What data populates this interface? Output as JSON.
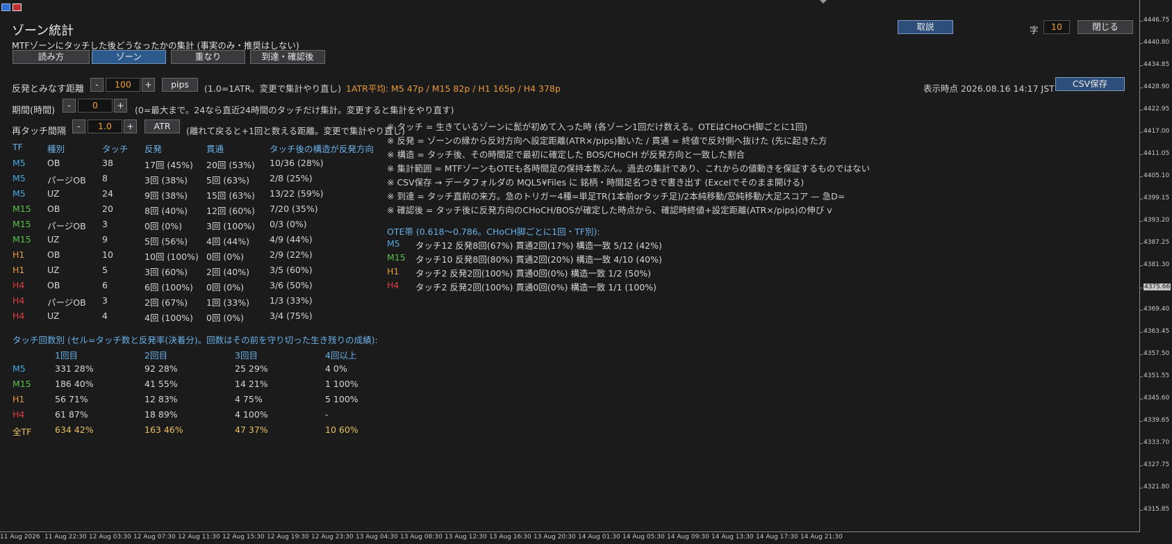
{
  "title": "ゾーン統計",
  "subtitle": "MTFゾーンにタッチした後どうなったかの集計 (事実のみ・推奨はしない)",
  "tabs": [
    "読み方",
    "ゾーン",
    "重なり",
    "到達・確認後"
  ],
  "active_tab": "ゾーン",
  "top_controls": {
    "explain_button": "取説",
    "font_label": "字",
    "font_size": "10",
    "close_button": "閉じる"
  },
  "reaction": {
    "label": "反発とみなす距離",
    "minus": "-",
    "value": "100",
    "plus": "+",
    "unit_button": "pips",
    "hint": "(1.0=1ATR。変更で集計やり直し)",
    "atr_avg": "1ATR平均: M5 47p / M15 82p / H1 165p / H4 378p",
    "timestamp": "表示時点 2026.08.16 14:17 JST",
    "csv_button": "CSV保存"
  },
  "period": {
    "label": "期間(時間)",
    "minus": "-",
    "value": "0",
    "plus": "+",
    "hint": "(0=最大まで。24なら直近24時間のタッチだけ集計。変更すると集計をやり直す)"
  },
  "retouch": {
    "label": "再タッチ間隔",
    "minus": "-",
    "value": "1.0",
    "plus": "+",
    "unit_button": "ATR",
    "hint": "(離れて戻ると+1回と数える距離。変更で集計やり直し)"
  },
  "table": {
    "headers": [
      "TF",
      "種別",
      "タッチ",
      "反発",
      "貫通",
      "タッチ後の構造が反発方向"
    ],
    "rows": [
      {
        "tf": "M5",
        "kind": "OB",
        "touch": "38",
        "bounce": "17回 (45%)",
        "pierce": "20回 (53%)",
        "struct": "10/36 (28%)"
      },
      {
        "tf": "M5",
        "kind": "パージOB",
        "touch": "8",
        "bounce": "3回 (38%)",
        "pierce": "5回 (63%)",
        "struct": "2/8 (25%)"
      },
      {
        "tf": "M5",
        "kind": "UZ",
        "touch": "24",
        "bounce": "9回 (38%)",
        "pierce": "15回 (63%)",
        "struct": "13/22 (59%)"
      },
      {
        "tf": "M15",
        "kind": "OB",
        "touch": "20",
        "bounce": "8回 (40%)",
        "pierce": "12回 (60%)",
        "struct": "7/20 (35%)"
      },
      {
        "tf": "M15",
        "kind": "パージOB",
        "touch": "3",
        "bounce": "0回 (0%)",
        "pierce": "3回 (100%)",
        "struct": "0/3 (0%)"
      },
      {
        "tf": "M15",
        "kind": "UZ",
        "touch": "9",
        "bounce": "5回 (56%)",
        "pierce": "4回 (44%)",
        "struct": "4/9 (44%)"
      },
      {
        "tf": "H1",
        "kind": "OB",
        "touch": "10",
        "bounce": "10回 (100%)",
        "pierce": "0回 (0%)",
        "struct": "2/9 (22%)"
      },
      {
        "tf": "H1",
        "kind": "UZ",
        "touch": "5",
        "bounce": "3回 (60%)",
        "pierce": "2回 (40%)",
        "struct": "3/5 (60%)"
      },
      {
        "tf": "H4",
        "kind": "OB",
        "touch": "6",
        "bounce": "6回 (100%)",
        "pierce": "0回 (0%)",
        "struct": "3/6 (50%)"
      },
      {
        "tf": "H4",
        "kind": "パージOB",
        "touch": "3",
        "bounce": "2回 (67%)",
        "pierce": "1回 (33%)",
        "struct": "1/3 (33%)"
      },
      {
        "tf": "H4",
        "kind": "UZ",
        "touch": "4",
        "bounce": "4回 (100%)",
        "pierce": "0回 (0%)",
        "struct": "3/4 (75%)"
      }
    ]
  },
  "touch_count": {
    "title": "タッチ回数別 (セル=タッチ数と反発率(決着分)。回数はその前を守り切った生き残りの成績):",
    "headers": [
      "1回目",
      "2回目",
      "3回目",
      "4回以上"
    ],
    "rows": [
      {
        "tf": "M5",
        "c1": "331 28%",
        "c2": "92 28%",
        "c3": "25 29%",
        "c4": "4 0%"
      },
      {
        "tf": "M15",
        "c1": "186 40%",
        "c2": "41 55%",
        "c3": "14 21%",
        "c4": "1 100%"
      },
      {
        "tf": "H1",
        "c1": "56 71%",
        "c2": "12 83%",
        "c3": "4 75%",
        "c4": "5 100%"
      },
      {
        "tf": "H4",
        "c1": "61 87%",
        "c2": "18 89%",
        "c3": "4 100%",
        "c4": "-"
      },
      {
        "tf": "全TF",
        "c1": "634 42%",
        "c2": "163 46%",
        "c3": "47 37%",
        "c4": "10 60%"
      }
    ]
  },
  "notes": [
    "※ タッチ = 生きているゾーンに髭が初めて入った時 (各ゾーン1回だけ数える。OTEはCHoCH脚ごとに1回)",
    "※ 反発 = ゾーンの縁から反対方向へ設定距離(ATR×/pips)動いた / 貫通 = 終値で反対側へ抜けた (先に起きた方",
    "※ 構造 = タッチ後、その時間足で最初に確定した BOS/CHoCH が反発方向と一致した割合",
    "※ 集計範囲 = MTFゾーンもOTEも各時間足の保持本数ぶん。過去の集計であり、これからの値動きを保証するものではない",
    "※ CSV保存 → データフォルダの MQL5¥Files に 銘柄・時間足名つきで書き出す (Excelでそのまま開ける)",
    "※ 到達 = タッチ直前の来方。急のトリガー4種=単足TR(1本前orタッチ足)/2本純移動/窓純移動/大足スコア — 急D=",
    "※ 確認後 = タッチ後に反発方向のCHoCH/BOSが確定した時点から、確認時終値+設定距離(ATR×/pips)の伸び v"
  ],
  "ote": {
    "title": "OTE帯 (0.618〜0.786。CHoCH脚ごとに1回・TF別):",
    "rows": [
      {
        "tf": "M5",
        "text": "タッチ12  反発8回(67%)  貫通2回(17%)  構造一致 5/12 (42%)"
      },
      {
        "tf": "M15",
        "text": "タッチ10  反発8回(80%)  貫通2回(20%)  構造一致 4/10 (40%)"
      },
      {
        "tf": "H1",
        "text": "タッチ2  反発2回(100%)  貫通0回(0%)  構造一致 1/2 (50%)"
      },
      {
        "tf": "H4",
        "text": "タッチ2  反発2回(100%)  貫通0回(0%)  構造一致 1/1 (100%)"
      }
    ]
  },
  "price_axis": [
    "4446.75",
    "4440.80",
    "4434.85",
    "4428.90",
    "4422.95",
    "4417.00",
    "4411.05",
    "4405.10",
    "4399.15",
    "4393.20",
    "4387.25",
    "4381.30",
    "4375.66",
    "4369.40",
    "4363.45",
    "4357.50",
    "4351.55",
    "4345.60",
    "4339.65",
    "4333.70",
    "4327.75",
    "4321.80",
    "4315.85"
  ],
  "current_price": "4375.66",
  "time_axis": [
    "11 Aug 2026",
    "11 Aug 22:30",
    "12 Aug 03:30",
    "12 Aug 07:30",
    "12 Aug 11:30",
    "12 Aug 15:30",
    "12 Aug 19:30",
    "12 Aug 23:30",
    "13 Aug 04:30",
    "13 Aug 08:30",
    "13 Aug 12:30",
    "13 Aug 16:30",
    "13 Aug 20:30",
    "14 Aug 01:30",
    "14 Aug 05:30",
    "14 Aug 09:30",
    "14 Aug 13:30",
    "14 Aug 17:30",
    "14 Aug 21:30"
  ],
  "colors": {
    "M5": "#4aa8e0",
    "M15": "#58c048",
    "H1": "#e89a3c",
    "H4": "#e03c3c",
    "total": "#e8c060",
    "header": "#69b0e6"
  }
}
